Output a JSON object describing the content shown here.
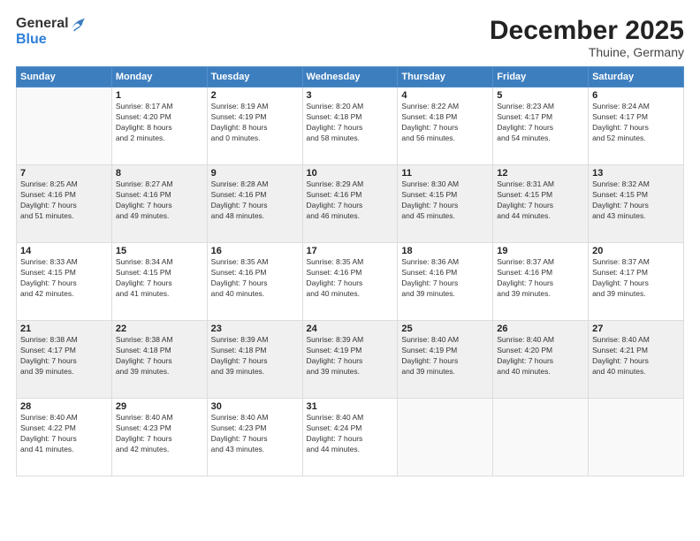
{
  "logo": {
    "general": "General",
    "blue": "Blue"
  },
  "header": {
    "month": "December 2025",
    "location": "Thuine, Germany"
  },
  "weekdays": [
    "Sunday",
    "Monday",
    "Tuesday",
    "Wednesday",
    "Thursday",
    "Friday",
    "Saturday"
  ],
  "weeks": [
    [
      {
        "day": "",
        "info": ""
      },
      {
        "day": "1",
        "info": "Sunrise: 8:17 AM\nSunset: 4:20 PM\nDaylight: 8 hours\nand 2 minutes."
      },
      {
        "day": "2",
        "info": "Sunrise: 8:19 AM\nSunset: 4:19 PM\nDaylight: 8 hours\nand 0 minutes."
      },
      {
        "day": "3",
        "info": "Sunrise: 8:20 AM\nSunset: 4:18 PM\nDaylight: 7 hours\nand 58 minutes."
      },
      {
        "day": "4",
        "info": "Sunrise: 8:22 AM\nSunset: 4:18 PM\nDaylight: 7 hours\nand 56 minutes."
      },
      {
        "day": "5",
        "info": "Sunrise: 8:23 AM\nSunset: 4:17 PM\nDaylight: 7 hours\nand 54 minutes."
      },
      {
        "day": "6",
        "info": "Sunrise: 8:24 AM\nSunset: 4:17 PM\nDaylight: 7 hours\nand 52 minutes."
      }
    ],
    [
      {
        "day": "7",
        "info": "Sunrise: 8:25 AM\nSunset: 4:16 PM\nDaylight: 7 hours\nand 51 minutes."
      },
      {
        "day": "8",
        "info": "Sunrise: 8:27 AM\nSunset: 4:16 PM\nDaylight: 7 hours\nand 49 minutes."
      },
      {
        "day": "9",
        "info": "Sunrise: 8:28 AM\nSunset: 4:16 PM\nDaylight: 7 hours\nand 48 minutes."
      },
      {
        "day": "10",
        "info": "Sunrise: 8:29 AM\nSunset: 4:16 PM\nDaylight: 7 hours\nand 46 minutes."
      },
      {
        "day": "11",
        "info": "Sunrise: 8:30 AM\nSunset: 4:15 PM\nDaylight: 7 hours\nand 45 minutes."
      },
      {
        "day": "12",
        "info": "Sunrise: 8:31 AM\nSunset: 4:15 PM\nDaylight: 7 hours\nand 44 minutes."
      },
      {
        "day": "13",
        "info": "Sunrise: 8:32 AM\nSunset: 4:15 PM\nDaylight: 7 hours\nand 43 minutes."
      }
    ],
    [
      {
        "day": "14",
        "info": "Sunrise: 8:33 AM\nSunset: 4:15 PM\nDaylight: 7 hours\nand 42 minutes."
      },
      {
        "day": "15",
        "info": "Sunrise: 8:34 AM\nSunset: 4:15 PM\nDaylight: 7 hours\nand 41 minutes."
      },
      {
        "day": "16",
        "info": "Sunrise: 8:35 AM\nSunset: 4:16 PM\nDaylight: 7 hours\nand 40 minutes."
      },
      {
        "day": "17",
        "info": "Sunrise: 8:35 AM\nSunset: 4:16 PM\nDaylight: 7 hours\nand 40 minutes."
      },
      {
        "day": "18",
        "info": "Sunrise: 8:36 AM\nSunset: 4:16 PM\nDaylight: 7 hours\nand 39 minutes."
      },
      {
        "day": "19",
        "info": "Sunrise: 8:37 AM\nSunset: 4:16 PM\nDaylight: 7 hours\nand 39 minutes."
      },
      {
        "day": "20",
        "info": "Sunrise: 8:37 AM\nSunset: 4:17 PM\nDaylight: 7 hours\nand 39 minutes."
      }
    ],
    [
      {
        "day": "21",
        "info": "Sunrise: 8:38 AM\nSunset: 4:17 PM\nDaylight: 7 hours\nand 39 minutes."
      },
      {
        "day": "22",
        "info": "Sunrise: 8:38 AM\nSunset: 4:18 PM\nDaylight: 7 hours\nand 39 minutes."
      },
      {
        "day": "23",
        "info": "Sunrise: 8:39 AM\nSunset: 4:18 PM\nDaylight: 7 hours\nand 39 minutes."
      },
      {
        "day": "24",
        "info": "Sunrise: 8:39 AM\nSunset: 4:19 PM\nDaylight: 7 hours\nand 39 minutes."
      },
      {
        "day": "25",
        "info": "Sunrise: 8:40 AM\nSunset: 4:19 PM\nDaylight: 7 hours\nand 39 minutes."
      },
      {
        "day": "26",
        "info": "Sunrise: 8:40 AM\nSunset: 4:20 PM\nDaylight: 7 hours\nand 40 minutes."
      },
      {
        "day": "27",
        "info": "Sunrise: 8:40 AM\nSunset: 4:21 PM\nDaylight: 7 hours\nand 40 minutes."
      }
    ],
    [
      {
        "day": "28",
        "info": "Sunrise: 8:40 AM\nSunset: 4:22 PM\nDaylight: 7 hours\nand 41 minutes."
      },
      {
        "day": "29",
        "info": "Sunrise: 8:40 AM\nSunset: 4:23 PM\nDaylight: 7 hours\nand 42 minutes."
      },
      {
        "day": "30",
        "info": "Sunrise: 8:40 AM\nSunset: 4:23 PM\nDaylight: 7 hours\nand 43 minutes."
      },
      {
        "day": "31",
        "info": "Sunrise: 8:40 AM\nSunset: 4:24 PM\nDaylight: 7 hours\nand 44 minutes."
      },
      {
        "day": "",
        "info": ""
      },
      {
        "day": "",
        "info": ""
      },
      {
        "day": "",
        "info": ""
      }
    ]
  ]
}
